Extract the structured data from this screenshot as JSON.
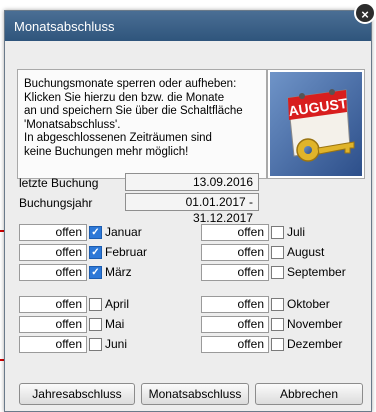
{
  "window": {
    "title": "Monatsabschluss",
    "close_glyph": "×"
  },
  "info": {
    "text": "Buchungsmonate sperren oder aufheben:\nKlicken Sie hierzu den bzw. die Monate\nan und speichern Sie über die Schaltfläche\n'Monatsabschluss'.\nIn abgeschlossenen Zeiträumen sind\nkeine Buchungen mehr möglich!"
  },
  "image": {
    "label": "AUGUST"
  },
  "fields": {
    "last_booking_label": "letzte Buchung",
    "last_booking_value": "13.09.2016",
    "year_label": "Buchungsjahr",
    "year_value": "01.01.2017 - 31.12.2017"
  },
  "months": [
    {
      "name": "Januar",
      "status": "offen",
      "checked": true
    },
    {
      "name": "Februar",
      "status": "offen",
      "checked": true
    },
    {
      "name": "März",
      "status": "offen",
      "checked": true
    },
    {
      "name": "April",
      "status": "offen",
      "checked": false
    },
    {
      "name": "Mai",
      "status": "offen",
      "checked": false
    },
    {
      "name": "Juni",
      "status": "offen",
      "checked": false
    },
    {
      "name": "Juli",
      "status": "offen",
      "checked": false
    },
    {
      "name": "August",
      "status": "offen",
      "checked": false
    },
    {
      "name": "September",
      "status": "offen",
      "checked": false
    },
    {
      "name": "Oktober",
      "status": "offen",
      "checked": false
    },
    {
      "name": "November",
      "status": "offen",
      "checked": false
    },
    {
      "name": "Dezember",
      "status": "offen",
      "checked": false
    }
  ],
  "buttons": {
    "year_close": "Jahresabschluss",
    "month_close": "Monatsabschluss",
    "cancel": "Abbrechen"
  },
  "colors": {
    "title_bar": "#3a6189",
    "annotation": "#d00000",
    "checkbox_checked": "#2d78d7"
  }
}
